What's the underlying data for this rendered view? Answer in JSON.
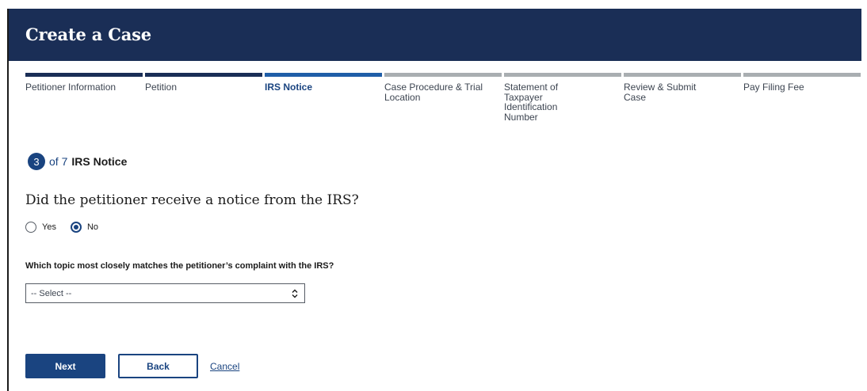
{
  "header": {
    "title": "Create a Case"
  },
  "steps": [
    {
      "label": "Petitioner Information",
      "state": "done"
    },
    {
      "label": "Petition",
      "state": "done"
    },
    {
      "label": "IRS Notice",
      "state": "current"
    },
    {
      "label": "Case Procedure & Trial Location",
      "state": "todo"
    },
    {
      "label": "Statement of Taxpayer Identification Number",
      "state": "todo"
    },
    {
      "label": "Review & Submit Case",
      "state": "todo"
    },
    {
      "label": "Pay Filing Fee",
      "state": "todo"
    }
  ],
  "step_counter": {
    "current": "3",
    "of_text": "of 7",
    "name": "IRS Notice"
  },
  "question": "Did the petitioner receive a notice from the IRS?",
  "radios": [
    {
      "label": "Yes",
      "checked": false
    },
    {
      "label": "No",
      "checked": true
    }
  ],
  "topic": {
    "label": "Which topic most closely matches the petitioner’s complaint with the IRS?",
    "select_value": "-- Select --"
  },
  "actions": {
    "next": "Next",
    "back": "Back",
    "cancel": "Cancel"
  },
  "colors": {
    "header": "#1a2e56",
    "accent": "#1a4480",
    "current_step": "#1f5ea8",
    "pending_step": "#a9aeb1"
  }
}
